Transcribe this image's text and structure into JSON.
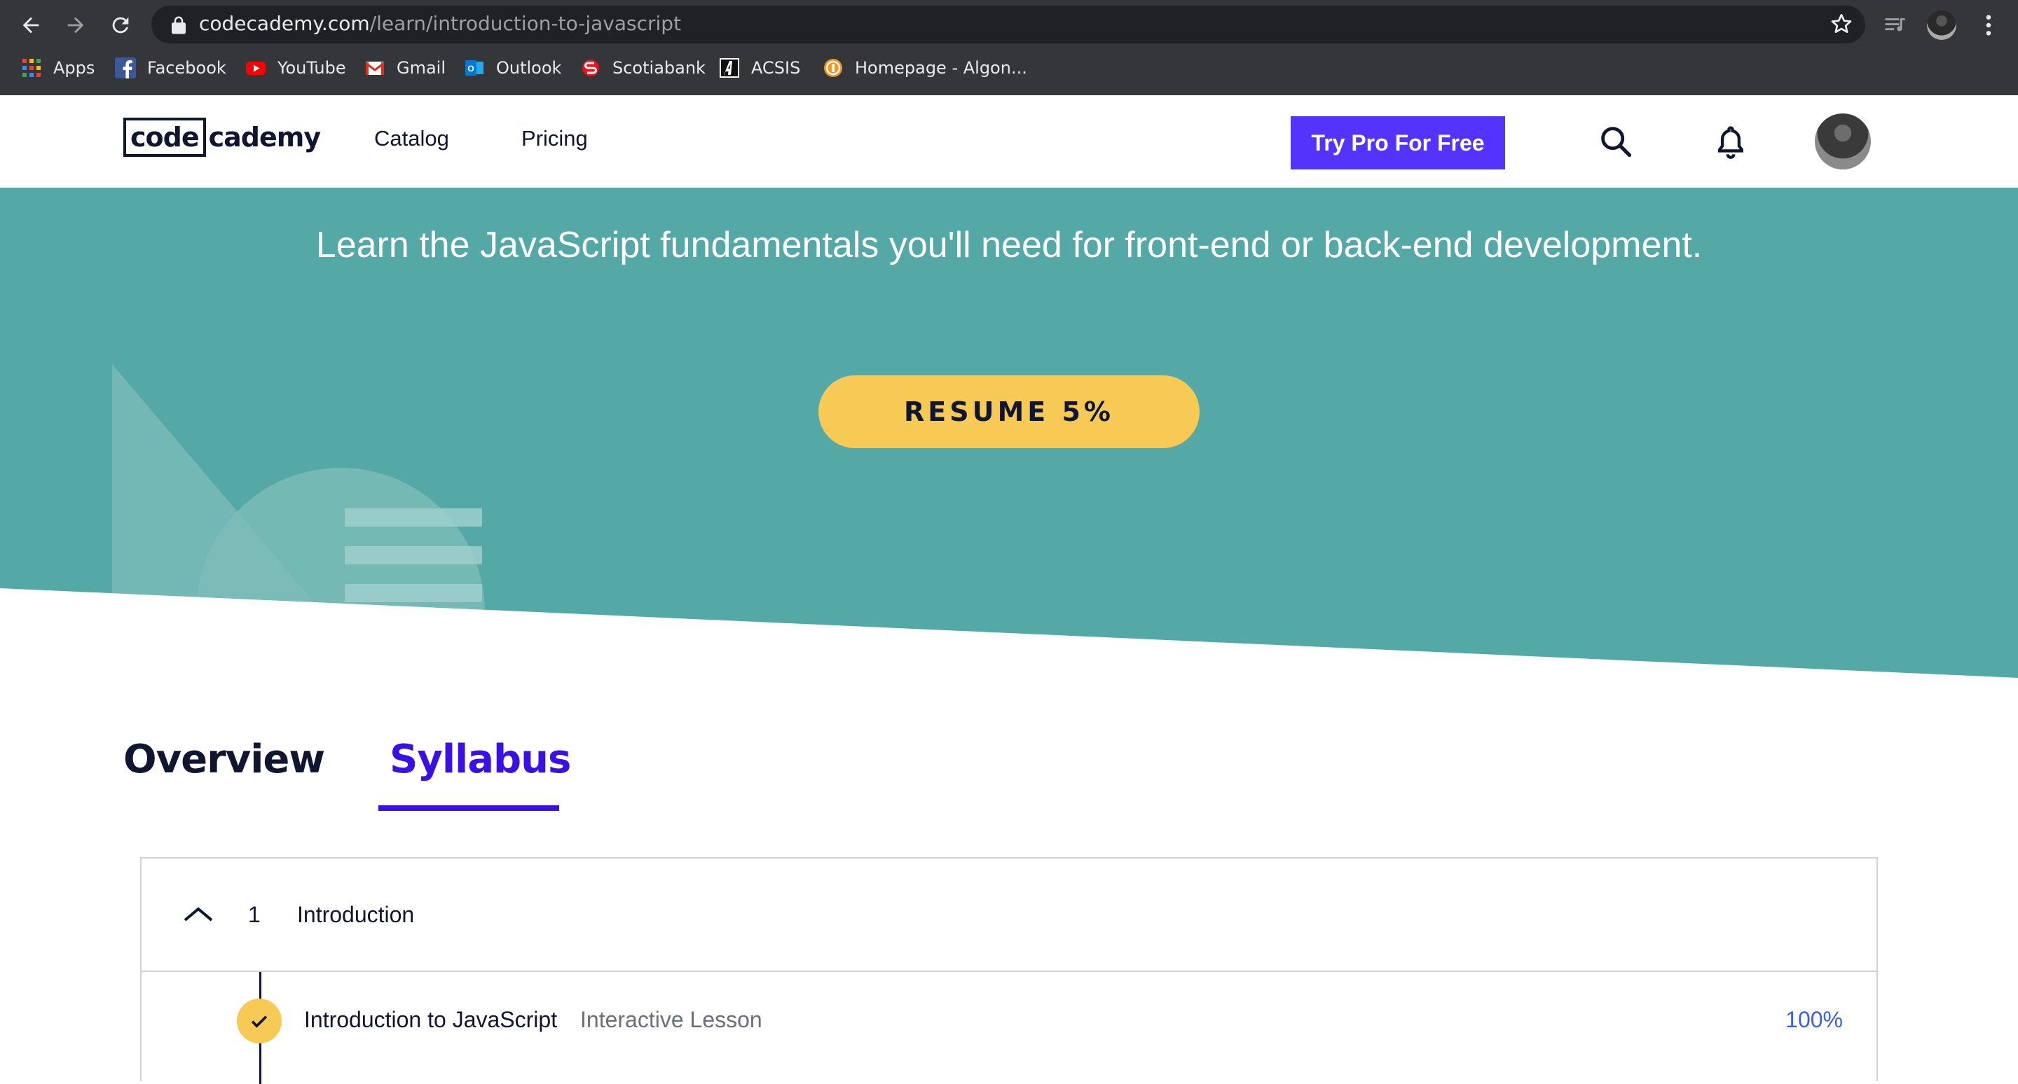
{
  "browser": {
    "url_host": "codecademy.com",
    "url_path": "/learn/introduction-to-javascript",
    "bookmarks": [
      {
        "label": "Apps",
        "icon": "apps-grid-icon"
      },
      {
        "label": "Facebook",
        "icon": "facebook-icon"
      },
      {
        "label": "YouTube",
        "icon": "youtube-icon"
      },
      {
        "label": "Gmail",
        "icon": "gmail-icon"
      },
      {
        "label": "Outlook",
        "icon": "outlook-icon"
      },
      {
        "label": "Scotiabank",
        "icon": "scotiabank-icon"
      },
      {
        "label": "ACSIS",
        "icon": "acsis-icon"
      },
      {
        "label": "Homepage - Algon...",
        "icon": "algonquin-icon"
      }
    ]
  },
  "header": {
    "logo_part1": "code",
    "logo_part2": "cademy",
    "nav": {
      "catalog": "Catalog",
      "pricing": "Pricing"
    },
    "cta": "Try Pro For Free",
    "cta_color": "#5533ff"
  },
  "hero": {
    "tagline": "Learn the JavaScript fundamentals you'll need for front-end or back-end development.",
    "resume_label": "RESUME 5%",
    "resume_progress": 0.05,
    "bg_color": "#54a8a6",
    "button_color": "#f7c955"
  },
  "tabs": {
    "overview": "Overview",
    "syllabus": "Syllabus",
    "active": "syllabus",
    "active_color": "#3a10e5"
  },
  "syllabus": {
    "module": {
      "number": "1",
      "title": "Introduction",
      "expanded": true
    },
    "lesson": {
      "title": "Introduction to JavaScript",
      "type": "Interactive Lesson",
      "progress": "100%",
      "completed": true
    }
  }
}
